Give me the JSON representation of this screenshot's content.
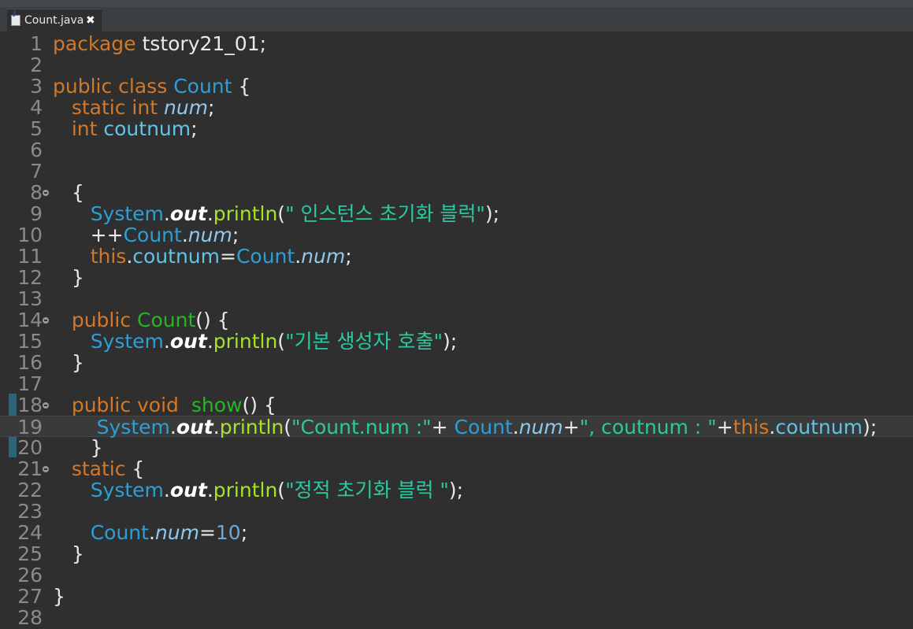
{
  "tab": {
    "filename": "Count.java",
    "close_glyph": "✖"
  },
  "colors": {
    "keyword": "#d2782a",
    "class": "#2d9fd6",
    "field": "#5fc4e8",
    "static_field": "#8ec8ee",
    "method": "#a6e22e",
    "method_decl": "#27b427",
    "string": "#2cc9a0",
    "plain": "#e8e8e8",
    "background": "#2f2f2f"
  },
  "editor": {
    "current_line": 19,
    "lines": [
      {
        "n": "1",
        "fold": false,
        "tokens": [
          [
            "kw",
            "package"
          ],
          [
            "pln",
            " tstory21_01;"
          ]
        ]
      },
      {
        "n": "2",
        "fold": false,
        "tokens": []
      },
      {
        "n": "3",
        "fold": false,
        "tokens": [
          [
            "kw",
            "public class"
          ],
          [
            "pln",
            " "
          ],
          [
            "cls",
            "Count"
          ],
          [
            "pln",
            " {"
          ]
        ]
      },
      {
        "n": "4",
        "fold": false,
        "tokens": [
          [
            "pln",
            "   "
          ],
          [
            "kw",
            "static int"
          ],
          [
            "pln",
            " "
          ],
          [
            "sfld",
            "num"
          ],
          [
            "pln",
            ";"
          ]
        ]
      },
      {
        "n": "5",
        "fold": false,
        "tokens": [
          [
            "pln",
            "   "
          ],
          [
            "kw",
            "int"
          ],
          [
            "pln",
            " "
          ],
          [
            "fld",
            "coutnum"
          ],
          [
            "pln",
            ";"
          ]
        ]
      },
      {
        "n": "6",
        "fold": false,
        "tokens": []
      },
      {
        "n": "7",
        "fold": false,
        "tokens": []
      },
      {
        "n": "8",
        "fold": true,
        "tokens": [
          [
            "pln",
            "   {"
          ]
        ]
      },
      {
        "n": "9",
        "fold": false,
        "tokens": [
          [
            "pln",
            "      "
          ],
          [
            "cls",
            "System"
          ],
          [
            "pln",
            "."
          ],
          [
            "out",
            "out"
          ],
          [
            "pln",
            "."
          ],
          [
            "mth",
            "println"
          ],
          [
            "pln",
            "("
          ],
          [
            "str",
            "\" 인스턴스 초기화 블럭\""
          ],
          [
            "pln",
            ");"
          ]
        ]
      },
      {
        "n": "10",
        "fold": false,
        "tokens": [
          [
            "pln",
            "      ++"
          ],
          [
            "cls",
            "Count"
          ],
          [
            "pln",
            "."
          ],
          [
            "sfld",
            "num"
          ],
          [
            "pln",
            ";"
          ]
        ]
      },
      {
        "n": "11",
        "fold": false,
        "tokens": [
          [
            "pln",
            "      "
          ],
          [
            "kw",
            "this"
          ],
          [
            "pln",
            "."
          ],
          [
            "fld",
            "coutnum"
          ],
          [
            "pln",
            "="
          ],
          [
            "cls",
            "Count"
          ],
          [
            "pln",
            "."
          ],
          [
            "sfld",
            "num"
          ],
          [
            "pln",
            ";"
          ]
        ]
      },
      {
        "n": "12",
        "fold": false,
        "tokens": [
          [
            "pln",
            "   }"
          ]
        ]
      },
      {
        "n": "13",
        "fold": false,
        "tokens": []
      },
      {
        "n": "14",
        "fold": true,
        "tokens": [
          [
            "pln",
            "   "
          ],
          [
            "kw",
            "public"
          ],
          [
            "pln",
            " "
          ],
          [
            "mdecl",
            "Count"
          ],
          [
            "pln",
            "() {"
          ]
        ]
      },
      {
        "n": "15",
        "fold": false,
        "tokens": [
          [
            "pln",
            "      "
          ],
          [
            "cls",
            "System"
          ],
          [
            "pln",
            "."
          ],
          [
            "out",
            "out"
          ],
          [
            "pln",
            "."
          ],
          [
            "mth",
            "println"
          ],
          [
            "pln",
            "("
          ],
          [
            "str",
            "\"기본 생성자 호출\""
          ],
          [
            "pln",
            ");"
          ]
        ]
      },
      {
        "n": "16",
        "fold": false,
        "tokens": [
          [
            "pln",
            "   }"
          ]
        ]
      },
      {
        "n": "17",
        "fold": false,
        "tokens": []
      },
      {
        "n": "18",
        "fold": true,
        "tokens": [
          [
            "pln",
            "   "
          ],
          [
            "kw",
            "public void"
          ],
          [
            "pln",
            "  "
          ],
          [
            "mdecl",
            "show"
          ],
          [
            "pln",
            "() {"
          ]
        ]
      },
      {
        "n": "19",
        "fold": false,
        "tokens": [
          [
            "pln",
            "       "
          ],
          [
            "cls",
            "System"
          ],
          [
            "pln",
            "."
          ],
          [
            "out",
            "out"
          ],
          [
            "pln",
            "."
          ],
          [
            "mth",
            "println"
          ],
          [
            "pln",
            "("
          ],
          [
            "str",
            "\"Count.num :\""
          ],
          [
            "pln",
            "+ "
          ],
          [
            "cls",
            "Count"
          ],
          [
            "pln",
            "."
          ],
          [
            "sfld",
            "num"
          ],
          [
            "pln",
            "+"
          ],
          [
            "str",
            "\", coutnum : \""
          ],
          [
            "pln",
            "+"
          ],
          [
            "kw",
            "this"
          ],
          [
            "pln",
            "."
          ],
          [
            "fld",
            "coutnum"
          ],
          [
            "pln",
            ");"
          ]
        ]
      },
      {
        "n": "20",
        "fold": false,
        "tokens": [
          [
            "pln",
            "      }"
          ]
        ]
      },
      {
        "n": "21",
        "fold": true,
        "tokens": [
          [
            "pln",
            "   "
          ],
          [
            "kw",
            "static"
          ],
          [
            "pln",
            " {"
          ]
        ]
      },
      {
        "n": "22",
        "fold": false,
        "tokens": [
          [
            "pln",
            "      "
          ],
          [
            "cls",
            "System"
          ],
          [
            "pln",
            "."
          ],
          [
            "out",
            "out"
          ],
          [
            "pln",
            "."
          ],
          [
            "mth",
            "println"
          ],
          [
            "pln",
            "("
          ],
          [
            "str",
            "\"정적 초기화 블럭 \""
          ],
          [
            "pln",
            ");"
          ]
        ]
      },
      {
        "n": "23",
        "fold": false,
        "tokens": []
      },
      {
        "n": "24",
        "fold": false,
        "tokens": [
          [
            "pln",
            "      "
          ],
          [
            "cls",
            "Count"
          ],
          [
            "pln",
            "."
          ],
          [
            "sfld",
            "num"
          ],
          [
            "pln",
            "="
          ],
          [
            "num",
            "10"
          ],
          [
            "pln",
            ";"
          ]
        ]
      },
      {
        "n": "25",
        "fold": false,
        "tokens": [
          [
            "pln",
            "   }"
          ]
        ]
      },
      {
        "n": "26",
        "fold": false,
        "tokens": []
      },
      {
        "n": "27",
        "fold": false,
        "tokens": [
          [
            "pln",
            "}"
          ]
        ]
      },
      {
        "n": "28",
        "fold": false,
        "tokens": []
      }
    ]
  }
}
